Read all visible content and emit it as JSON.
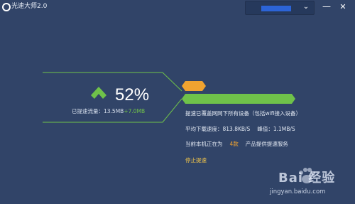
{
  "window": {
    "title": "光速大师2.0"
  },
  "speed": {
    "percent": "52%",
    "traffic_label": "已提速流量：13.5MB",
    "traffic_delta": "+7.0MB"
  },
  "info": {
    "line1": "提速已覆盖网网下所有设备（包括wifi接入设备）",
    "avg_label": "平均下载速度：813.8KB/S",
    "peak_label": "峰值：1.1MB/S",
    "boost_prefix": "当前本机正在为",
    "boost_count": "4款",
    "boost_suffix": "产品提供提速服务",
    "stop_label": "停止提速"
  },
  "watermark": {
    "brand": "Bai 经验",
    "url": "jingyan.baidu.com"
  },
  "colors": {
    "background": "#314468",
    "accent_green": "#6fc24a",
    "accent_orange": "#f0a330",
    "link_yellow": "#f3c64a"
  },
  "icons": {
    "logo": "app-logo-icon",
    "up": "up-arrow-icon",
    "dropdown": "chevron-down-icon",
    "minimize": "minimize-icon",
    "close": "close-icon"
  }
}
